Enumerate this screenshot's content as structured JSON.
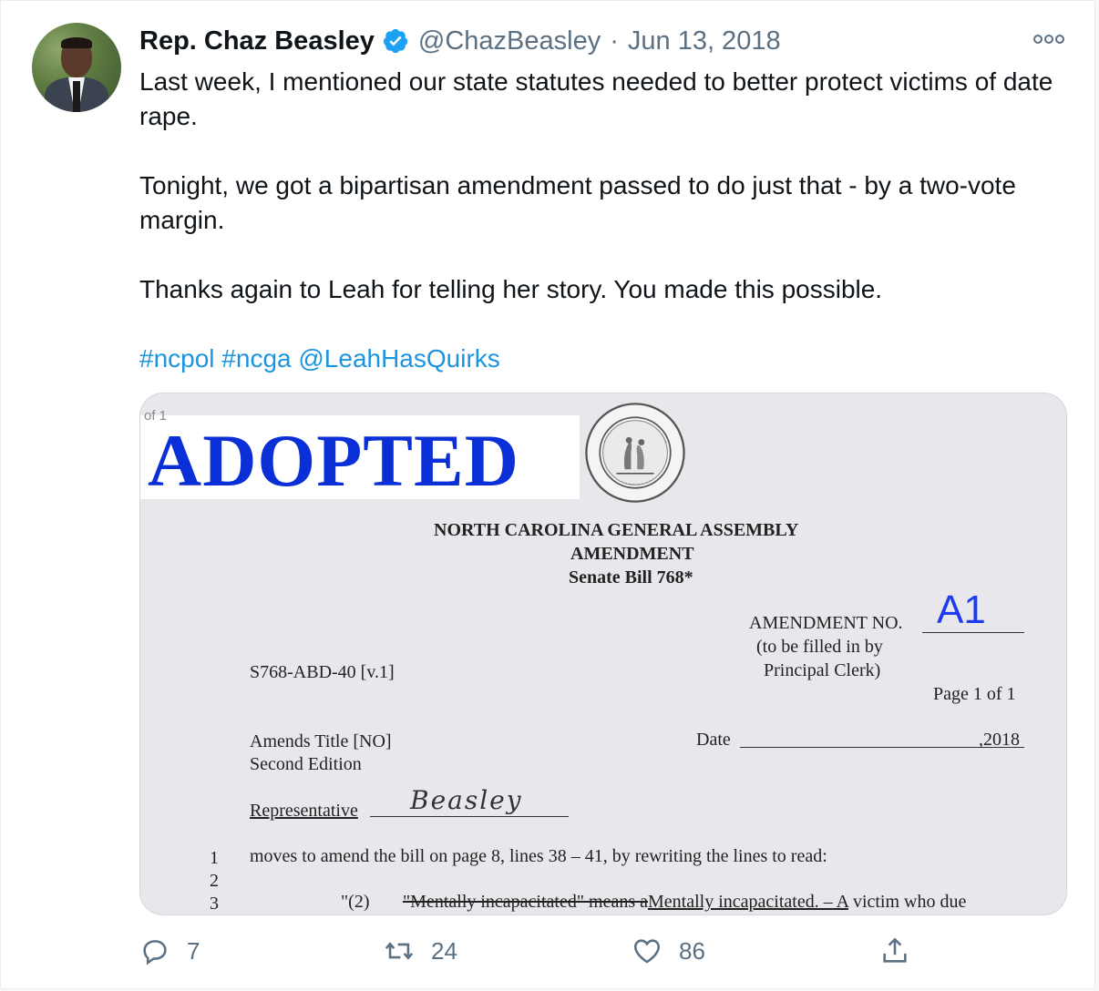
{
  "author": {
    "name": "Rep. Chaz Beasley",
    "handle": "@ChazBeasley",
    "separator": "·",
    "date": "Jun 13, 2018"
  },
  "tweet": {
    "line1": "Last week, I mentioned our state statutes needed to better protect victims of date rape.",
    "line2": "Tonight, we got a bipartisan amendment passed to do just that - by a two-vote margin.",
    "line3": "Thanks again to Leah for telling her story. You made this possible.",
    "tags": [
      "#ncpol",
      "#ncga",
      "@LeahHasQuirks"
    ]
  },
  "media": {
    "counter": "of 1",
    "stamp": "ADOPTED",
    "assembly": "NORTH CAROLINA GENERAL ASSEMBLY",
    "amendment": "AMENDMENT",
    "bill": "Senate Bill 768*",
    "amendment_no_label": "AMENDMENT NO.",
    "amendment_no": "A1",
    "filled_by_1": "(to be filled in by",
    "filled_by_2": "Principal Clerk)",
    "code": "S768-ABD-40 [v.1]",
    "page": "Page 1 of 1",
    "amends": "Amends Title [NO]",
    "edition": "Second Edition",
    "date_label": "Date",
    "date_value": ",2018",
    "rep_label": "Representative",
    "signature": "Beasley",
    "line_nums": [
      "1",
      "2",
      "3"
    ],
    "line1": "moves to amend the bill on page 8, lines 38 – 41, by rewriting the lines to read:",
    "line3_num": "\"(2)",
    "line3_strike": "\"Mentally incapacitated\" means a",
    "line3_under": "Mentally incapacitated. – A",
    "line3_rest": " victim who due"
  },
  "actions": {
    "reply_count": "7",
    "retweet_count": "24",
    "like_count": "86"
  },
  "colors": {
    "link": "#1b95e0",
    "muted": "#5b7083",
    "verified": "#1da1f2",
    "stamp": "#0a2fd6"
  }
}
